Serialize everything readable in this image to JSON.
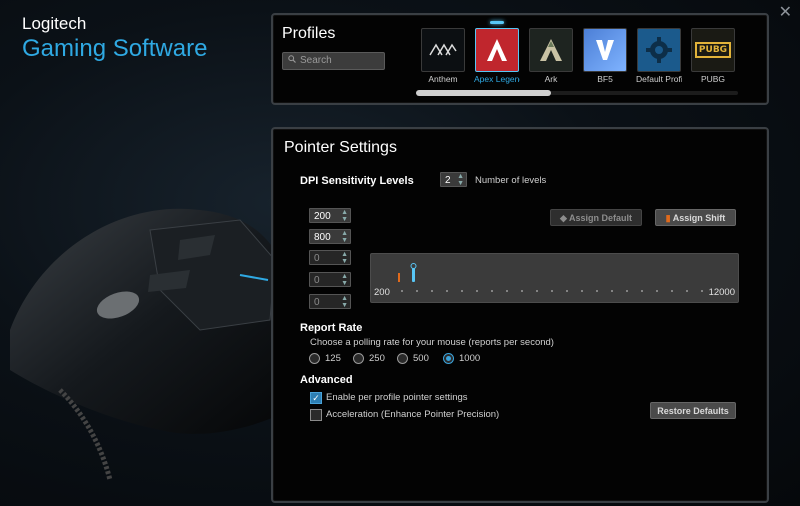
{
  "brand": {
    "line1": "Logitech",
    "line2": "Gaming Software"
  },
  "window": {
    "close_glyph": "✕"
  },
  "profiles": {
    "title": "Profiles",
    "search_placeholder": "Search",
    "items": [
      {
        "name": "Anthem",
        "icon": "anthem-icon"
      },
      {
        "name": "Apex Legend",
        "icon": "apex-legends-icon",
        "active": true
      },
      {
        "name": "Ark",
        "icon": "ark-icon"
      },
      {
        "name": "BF5",
        "icon": "bf5-icon"
      },
      {
        "name": "Default Profil",
        "icon": "default-profile-gear-icon"
      },
      {
        "name": "PUBG",
        "icon": "pubg-icon"
      }
    ]
  },
  "pointer": {
    "title": "Pointer Settings",
    "dpi_label": "DPI Sensitivity Levels",
    "levels_value": "2",
    "levels_label": "Number of levels",
    "dpi_values": [
      "200",
      "800",
      "0",
      "0",
      "0"
    ],
    "assign_default": "Assign Default",
    "assign_shift": "Assign Shift",
    "slider_min": "200",
    "slider_max": "12000",
    "report_rate_label": "Report Rate",
    "report_rate_desc": "Choose a polling rate for your mouse (reports per second)",
    "rates": [
      "125",
      "250",
      "500",
      "1000"
    ],
    "selected_rate": "1000",
    "advanced_label": "Advanced",
    "enable_profile_settings": "Enable per profile pointer settings",
    "acceleration": "Acceleration (Enhance Pointer Precision)",
    "restore_defaults": "Restore Defaults"
  },
  "colors": {
    "accent": "#2fa9e3",
    "shift": "#e06a1c",
    "panel_bg": "#030303"
  }
}
